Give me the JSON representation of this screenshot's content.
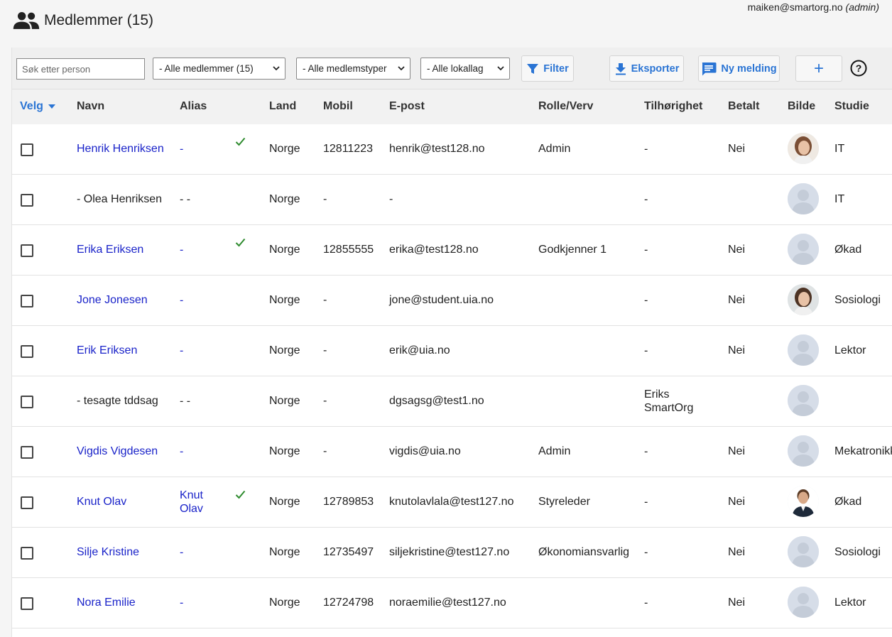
{
  "header": {
    "user_email": "maiken@smartorg.no",
    "user_role": "(admin)",
    "title": "Medlemmer (15)"
  },
  "toolbar": {
    "search_placeholder": "Søk etter person",
    "select_members": "- Alle medlemmer (15)",
    "select_types": "- Alle medlemstyper",
    "select_branches": "- Alle lokallag",
    "filter_label": "Filter",
    "export_label": "Eksporter",
    "message_label": "Ny melding",
    "add_label": "+",
    "help_label": "?"
  },
  "table": {
    "headers": {
      "velg": "Velg",
      "navn": "Navn",
      "alias": "Alias",
      "land": "Land",
      "mobil": "Mobil",
      "epost": "E-post",
      "rolle": "Rolle/Verv",
      "tilhorighet": "Tilhørighet",
      "betalt": "Betalt",
      "bilde": "Bilde",
      "studie": "Studie"
    },
    "rows": [
      {
        "name": "Henrik Henriksen",
        "alias": "-",
        "check": true,
        "land": "Norge",
        "mobil": "12811223",
        "epost": "henrik@test128.no",
        "rolle": "Admin",
        "tilhorighet": "-",
        "betalt": "Nei",
        "studie": "IT",
        "linked": true,
        "photo": "woman-1"
      },
      {
        "name": "- Olea Henriksen",
        "alias": "- -",
        "check": false,
        "land": "Norge",
        "mobil": "-",
        "epost": "-",
        "rolle": "",
        "tilhorighet": "-",
        "betalt": "",
        "studie": "IT",
        "linked": false,
        "photo": "placeholder"
      },
      {
        "name": "Erika Eriksen",
        "alias": "-",
        "check": true,
        "land": "Norge",
        "mobil": "12855555",
        "epost": "erika@test128.no",
        "rolle": "Godkjenner 1",
        "tilhorighet": "-",
        "betalt": "Nei",
        "studie": "Økad",
        "linked": true,
        "photo": "placeholder"
      },
      {
        "name": "Jone Jonesen",
        "alias": "-",
        "check": false,
        "land": "Norge",
        "mobil": "-",
        "epost": "jone@student.uia.no",
        "rolle": "",
        "tilhorighet": "-",
        "betalt": "Nei",
        "studie": "Sosiologi",
        "linked": true,
        "photo": "woman-2"
      },
      {
        "name": "Erik Eriksen",
        "alias": "-",
        "check": false,
        "land": "Norge",
        "mobil": "-",
        "epost": "erik@uia.no",
        "rolle": "",
        "tilhorighet": "-",
        "betalt": "Nei",
        "studie": "Lektor",
        "linked": true,
        "photo": "placeholder"
      },
      {
        "name": "- tesagte tddsag",
        "alias": "- -",
        "check": false,
        "land": "Norge",
        "mobil": "-",
        "epost": "dgsagsg@test1.no",
        "rolle": "",
        "tilhorighet": "Eriks SmartOrg",
        "betalt": "",
        "studie": "",
        "linked": false,
        "photo": "placeholder"
      },
      {
        "name": "Vigdis Vigdesen",
        "alias": "-",
        "check": false,
        "land": "Norge",
        "mobil": "-",
        "epost": "vigdis@uia.no",
        "rolle": "Admin",
        "tilhorighet": "-",
        "betalt": "Nei",
        "studie": "Mekatronikk",
        "linked": true,
        "photo": "placeholder"
      },
      {
        "name": "Knut Olav",
        "alias": "Knut Olav",
        "check": true,
        "land": "Norge",
        "mobil": "12789853",
        "epost": "knutolavlala@test127.no",
        "rolle": "Styreleder",
        "tilhorighet": "-",
        "betalt": "Nei",
        "studie": "Økad",
        "linked": true,
        "photo": "man-1"
      },
      {
        "name": "Silje Kristine",
        "alias": "-",
        "check": false,
        "land": "Norge",
        "mobil": "12735497",
        "epost": "siljekristine@test127.no",
        "rolle": "Økonomiansvarlig",
        "tilhorighet": "-",
        "betalt": "Nei",
        "studie": "Sosiologi",
        "linked": true,
        "photo": "placeholder"
      },
      {
        "name": "Nora Emilie",
        "alias": "-",
        "check": false,
        "land": "Norge",
        "mobil": "12724798",
        "epost": "noraemilie@test127.no",
        "rolle": "",
        "tilhorighet": "-",
        "betalt": "Nei",
        "studie": "Lektor",
        "linked": true,
        "photo": "placeholder"
      }
    ]
  },
  "colors": {
    "accent": "#2a74d4",
    "link": "#1a23c9",
    "check": "#2e8b2e"
  }
}
